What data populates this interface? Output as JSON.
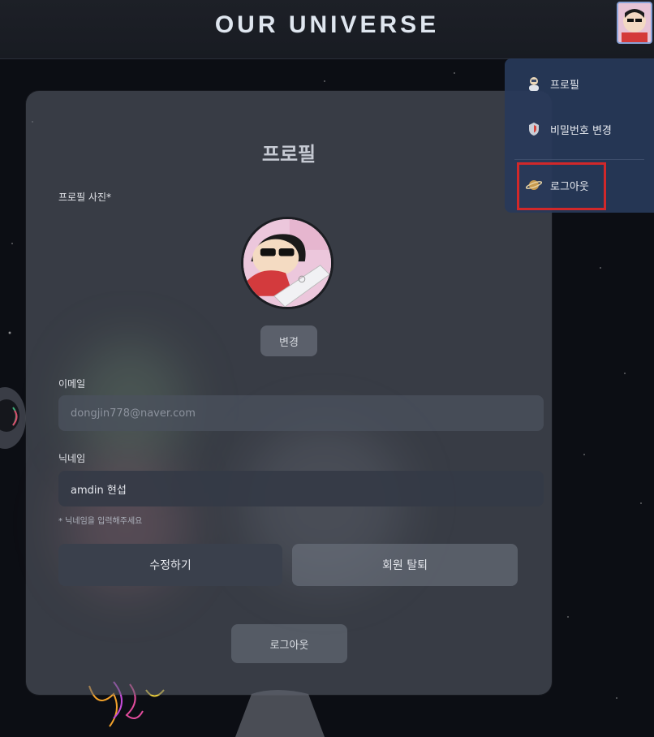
{
  "header": {
    "brand": "OUR UNIVERSE",
    "avatar_icon": "user-avatar"
  },
  "profile": {
    "title": "프로필",
    "photo_label": "프로필 사진*",
    "change_button": "변경",
    "email_label": "이메일",
    "email_value": "dongjin778@naver.com",
    "nickname_label": "닉네임",
    "nickname_value": "amdin 현섭",
    "nickname_hint": "* 닉네임을 입력해주세요",
    "save_button": "수정하기",
    "withdraw_button": "회원 탈퇴",
    "logout_button": "로그아웃"
  },
  "dropdown": {
    "items": [
      {
        "label": "프로필",
        "icon": "astronaut-icon"
      },
      {
        "label": "비밀번호 변경",
        "icon": "shield-icon"
      },
      {
        "label": "로그아웃",
        "icon": "planet-icon"
      }
    ]
  },
  "colors": {
    "background": "#0c0e14",
    "header": "#1b1e25",
    "dropdown": "#283a5a",
    "highlight": "#d1282a",
    "primary_button": "#3a404c"
  }
}
